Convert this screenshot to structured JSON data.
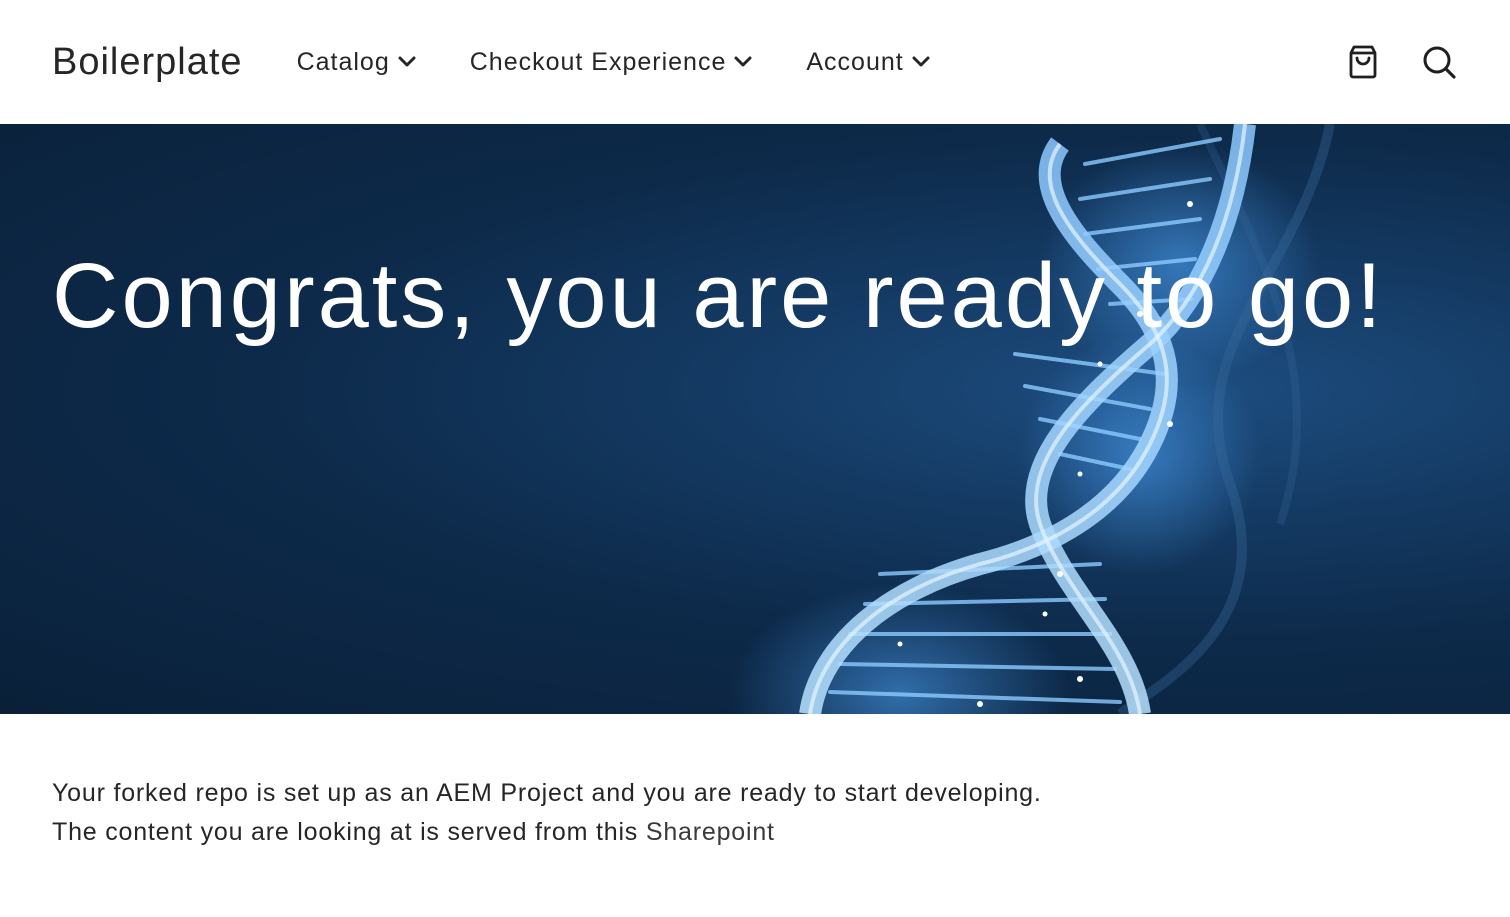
{
  "header": {
    "brand": "Boilerplate",
    "nav": [
      {
        "label": "Catalog",
        "icon": "chevron-down-icon"
      },
      {
        "label": "Checkout Experience",
        "icon": "chevron-down-icon"
      },
      {
        "label": "Account",
        "icon": "chevron-down-icon"
      }
    ],
    "tools": {
      "cart_icon": "shopping-bag-icon",
      "search_icon": "search-icon"
    }
  },
  "hero": {
    "title": "Congrats, you are ready to go!",
    "image": "dna-helix-illustration",
    "colors": {
      "background": "#0d2a4a",
      "helix": "#7fc4ff"
    }
  },
  "content": {
    "line1": "Your forked repo is set up as an AEM Project and you are ready to start developing.",
    "line2_prefix": "The content you are looking at is served from this ",
    "link_label": "Sharepoint"
  }
}
